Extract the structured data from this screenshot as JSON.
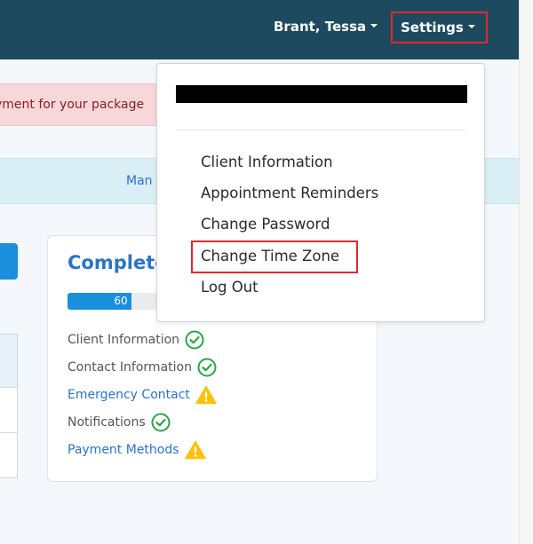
{
  "navbar": {
    "user_label": "Brant, Tessa",
    "settings_label": "Settings"
  },
  "alert": {
    "text": "yment for your package"
  },
  "info_bar": {
    "link_text": "Man"
  },
  "completion_card": {
    "title": "Complete",
    "progress_label": "60",
    "progress_value": 0.6,
    "items": [
      {
        "label": "Client Information",
        "status": "complete",
        "icon": "check-circle-icon"
      },
      {
        "label": "Contact Information",
        "status": "complete",
        "icon": "check-circle-icon"
      },
      {
        "label": "Emergency Contact",
        "status": "warning",
        "icon": "warning-icon"
      },
      {
        "label": "Notifications",
        "status": "complete",
        "icon": "check-circle-icon"
      },
      {
        "label": "Payment Methods",
        "status": "warning",
        "icon": "warning-icon"
      }
    ]
  },
  "settings_menu": {
    "items": [
      {
        "label": "Client Information"
      },
      {
        "label": "Appointment Reminders"
      },
      {
        "label": "Change Password"
      },
      {
        "label": "Change Time Zone",
        "highlighted": true
      },
      {
        "label": "Log Out"
      }
    ]
  },
  "colors": {
    "navbar": "#1d4a5e",
    "accent": "#2b74c7",
    "progress": "#1a8fdc",
    "success": "#28a745",
    "warning": "#ffc107",
    "highlight_border": "#e0282e"
  }
}
